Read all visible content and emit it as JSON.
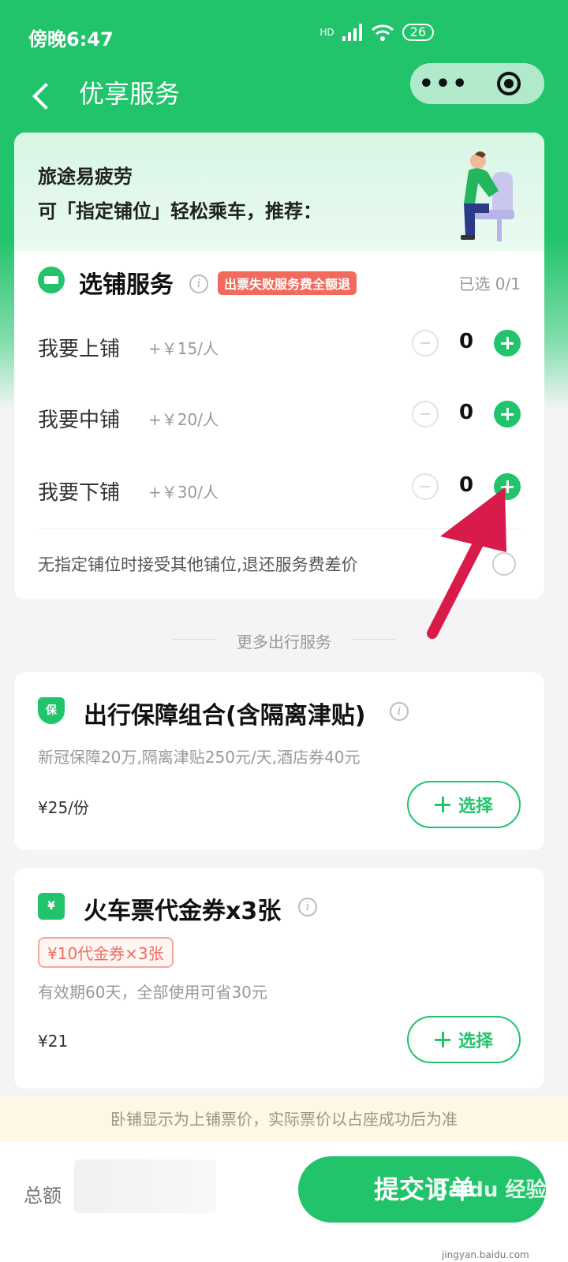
{
  "status_bar": {
    "time": "傍晚6:47",
    "network": "HD",
    "battery": "26"
  },
  "nav": {
    "title": "优享服务"
  },
  "promo": {
    "line1": "旅途易疲劳",
    "line2": "可「指定铺位」轻松乘车，推荐："
  },
  "berth_service": {
    "title": "选铺服务",
    "badge": "出票失败服务费全额退",
    "selected": "已选 0/1",
    "rows": [
      {
        "label": "我要上铺",
        "price": "+￥15/人",
        "qty": "0"
      },
      {
        "label": "我要中铺",
        "price": "+￥20/人",
        "qty": "0"
      },
      {
        "label": "我要下铺",
        "price": "+￥30/人",
        "qty": "0"
      }
    ],
    "accept_text": "无指定铺位时接受其他铺位,退还服务费差价"
  },
  "more_services": {
    "title": "更多出行服务"
  },
  "insurance": {
    "icon_text": "保",
    "title": "出行保障组合(含隔离津贴)",
    "desc": "新冠保障20万,隔离津贴250元/天,酒店券40元",
    "price": "¥25/份",
    "choose": "选择"
  },
  "coupon": {
    "icon_text": "¥",
    "title": "火车票代金券x3张",
    "tag": "¥10代金券×3张",
    "desc": "有效期60天，全部使用可省30元",
    "price": "¥21",
    "choose": "选择"
  },
  "notice": "卧铺显示为上铺票价，实际票价以占座成功后为准",
  "footer": {
    "total_label": "总额",
    "submit": "提交订单",
    "watermark": "Baidu 经验",
    "watermark_sub": "jingyan.baidu.com"
  },
  "colors": {
    "accent": "#21c36b",
    "badge": "#f26a5c",
    "annotation_arrow": "#d81b4a"
  }
}
